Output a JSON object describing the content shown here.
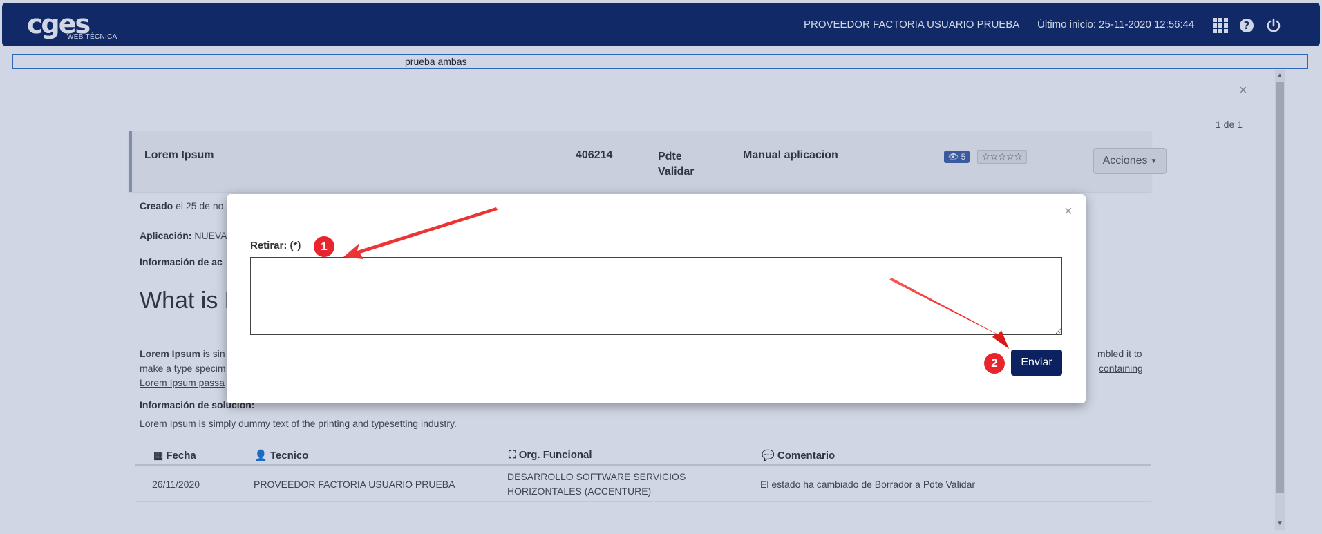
{
  "header": {
    "logo_main": "cges",
    "logo_sub": "WEB TÉCNICA",
    "user_name": "PROVEEDOR FACTORIA USUARIO PRUEBA",
    "last_login": "Último inicio: 25-11-2020 12:56:44",
    "icons": [
      "grid-icon",
      "help-icon",
      "power-icon"
    ]
  },
  "search": {
    "value": "prueba ambas"
  },
  "panel": {
    "pager": "1 de 1",
    "close": "×"
  },
  "ticket": {
    "title": "Lorem Ipsum",
    "id": "406214",
    "state": "Pdte Validar",
    "type": "Manual aplicacion",
    "views": "5",
    "stars": "☆☆☆☆☆",
    "actions_label": "Acciones"
  },
  "details": {
    "created_label": "Creado",
    "created_text": " el 25 de no",
    "app_label": "Aplicación:",
    "app_text": " NUEVA",
    "info_label": "Información de ac",
    "heading": "What is L",
    "para_bold": "Lorem Ipsum",
    "para_line1_start": " is sin",
    "para_line1_end": "mbled it to",
    "para_line2_start": "make a type specim",
    "para_line2_end": "containing",
    "para_line3": "Lorem Ipsum passa",
    "solution_label": "Información de solución:",
    "solution_text": "Lorem Ipsum is simply dummy text of the printing and typesetting industry."
  },
  "table": {
    "headers": [
      "Fecha",
      "Tecnico",
      "Org. Funcional",
      "Comentario"
    ],
    "rows": [
      {
        "fecha": "26/11/2020",
        "tecnico": "PROVEEDOR FACTORIA USUARIO PRUEBA",
        "org": "DESARROLLO SOFTWARE SERVICIOS HORIZONTALES (ACCENTURE)",
        "comentario": "El estado ha cambiado de Borrador a Pdte Validar"
      }
    ]
  },
  "modal": {
    "close": "×",
    "label": "Retirar: (*)",
    "textarea_value": "",
    "submit_label": "Enviar"
  },
  "annotations": {
    "marker_1": "1",
    "marker_2": "2",
    "color": "#e8252d"
  },
  "colors": {
    "brand": "#0c2260",
    "badge": "#3e61a6"
  }
}
